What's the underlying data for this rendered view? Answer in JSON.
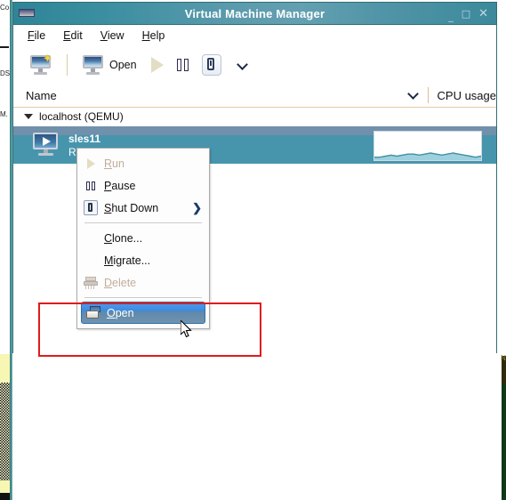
{
  "window": {
    "title": "Virtual Machine Manager",
    "icon": "vmm-app-icon",
    "controls": {
      "minimize": "_",
      "maximize": "□",
      "close": "✕"
    }
  },
  "menubar": {
    "items": [
      {
        "label": "File",
        "mnemonic": "F",
        "rest": "ile"
      },
      {
        "label": "Edit",
        "mnemonic": "E",
        "rest": "dit"
      },
      {
        "label": "View",
        "mnemonic": "V",
        "rest": "iew"
      },
      {
        "label": "Help",
        "mnemonic": "H",
        "rest": "elp"
      }
    ]
  },
  "toolbar": {
    "new_vm_label": "",
    "new_vm_icon": "new-vm-icon",
    "open_label": "Open",
    "open_icon": "open-monitor-icon",
    "run_icon": "run-play-icon",
    "pause_icon": "pause-icon",
    "shutdown_icon": "shutdown-power-icon",
    "dropdown_icon": "chevron-down-icon"
  },
  "columns": {
    "name": "Name",
    "cpu_usage": "CPU usage",
    "sort_icon": "chevron-down-icon"
  },
  "host": {
    "label": "localhost (QEMU)",
    "expander": "triangle-down-icon",
    "expanded": true
  },
  "vm": {
    "name": "sles11",
    "state": "Running",
    "icon": "vm-running-monitor-icon",
    "selected": true,
    "cpu_sparkline": [
      2,
      2,
      3,
      4,
      3,
      4,
      5,
      5,
      4,
      5,
      6,
      5,
      4,
      5,
      6,
      5,
      4,
      3,
      2,
      3
    ]
  },
  "context_menu": {
    "items": [
      {
        "id": "run",
        "label": "Run",
        "mnemonic": "R",
        "rest": "un",
        "icon": "run-play-icon",
        "disabled": true,
        "separator_after": false,
        "submenu": false,
        "highlighted": false
      },
      {
        "id": "pause",
        "label": "Pause",
        "mnemonic": "P",
        "rest": "ause",
        "icon": "pause-icon",
        "disabled": false,
        "separator_after": false,
        "submenu": false,
        "highlighted": false
      },
      {
        "id": "shutdown",
        "label": "Shut Down",
        "mnemonic": "S",
        "rest": "hut Down",
        "icon": "shutdown-power-icon",
        "disabled": false,
        "separator_after": true,
        "submenu": true,
        "highlighted": false
      },
      {
        "id": "clone",
        "label": "Clone...",
        "mnemonic": "C",
        "rest": "lone...",
        "icon": "",
        "disabled": false,
        "separator_after": false,
        "submenu": false,
        "highlighted": false
      },
      {
        "id": "migrate",
        "label": "Migrate...",
        "mnemonic": "M",
        "rest": "igrate...",
        "icon": "",
        "disabled": false,
        "separator_after": false,
        "submenu": false,
        "highlighted": false
      },
      {
        "id": "delete",
        "label": "Delete",
        "mnemonic": "D",
        "rest": "elete",
        "icon": "delete-shredder-icon",
        "disabled": true,
        "separator_after": true,
        "submenu": false,
        "highlighted": false
      },
      {
        "id": "open",
        "label": "Open",
        "mnemonic": "O",
        "rest": "pen",
        "icon": "open-folder-icon",
        "disabled": false,
        "separator_after": false,
        "submenu": false,
        "highlighted": true
      }
    ],
    "submenu_arrow": "❯"
  },
  "annotation": {
    "shape": "rectangle",
    "color": "#e01b1b",
    "target": "open-menu-item"
  },
  "colors": {
    "titlebar_teal": "#4f93a6",
    "selection_teal": "#4795ad",
    "row_top_band": "#7190ab",
    "menu_highlight_blue": "#3c8ae0",
    "annotation_red": "#e01b1b"
  },
  "background_fragments": {
    "left_texts": [
      "Co",
      "DS",
      "M."
    ],
    "right_char": "N"
  }
}
